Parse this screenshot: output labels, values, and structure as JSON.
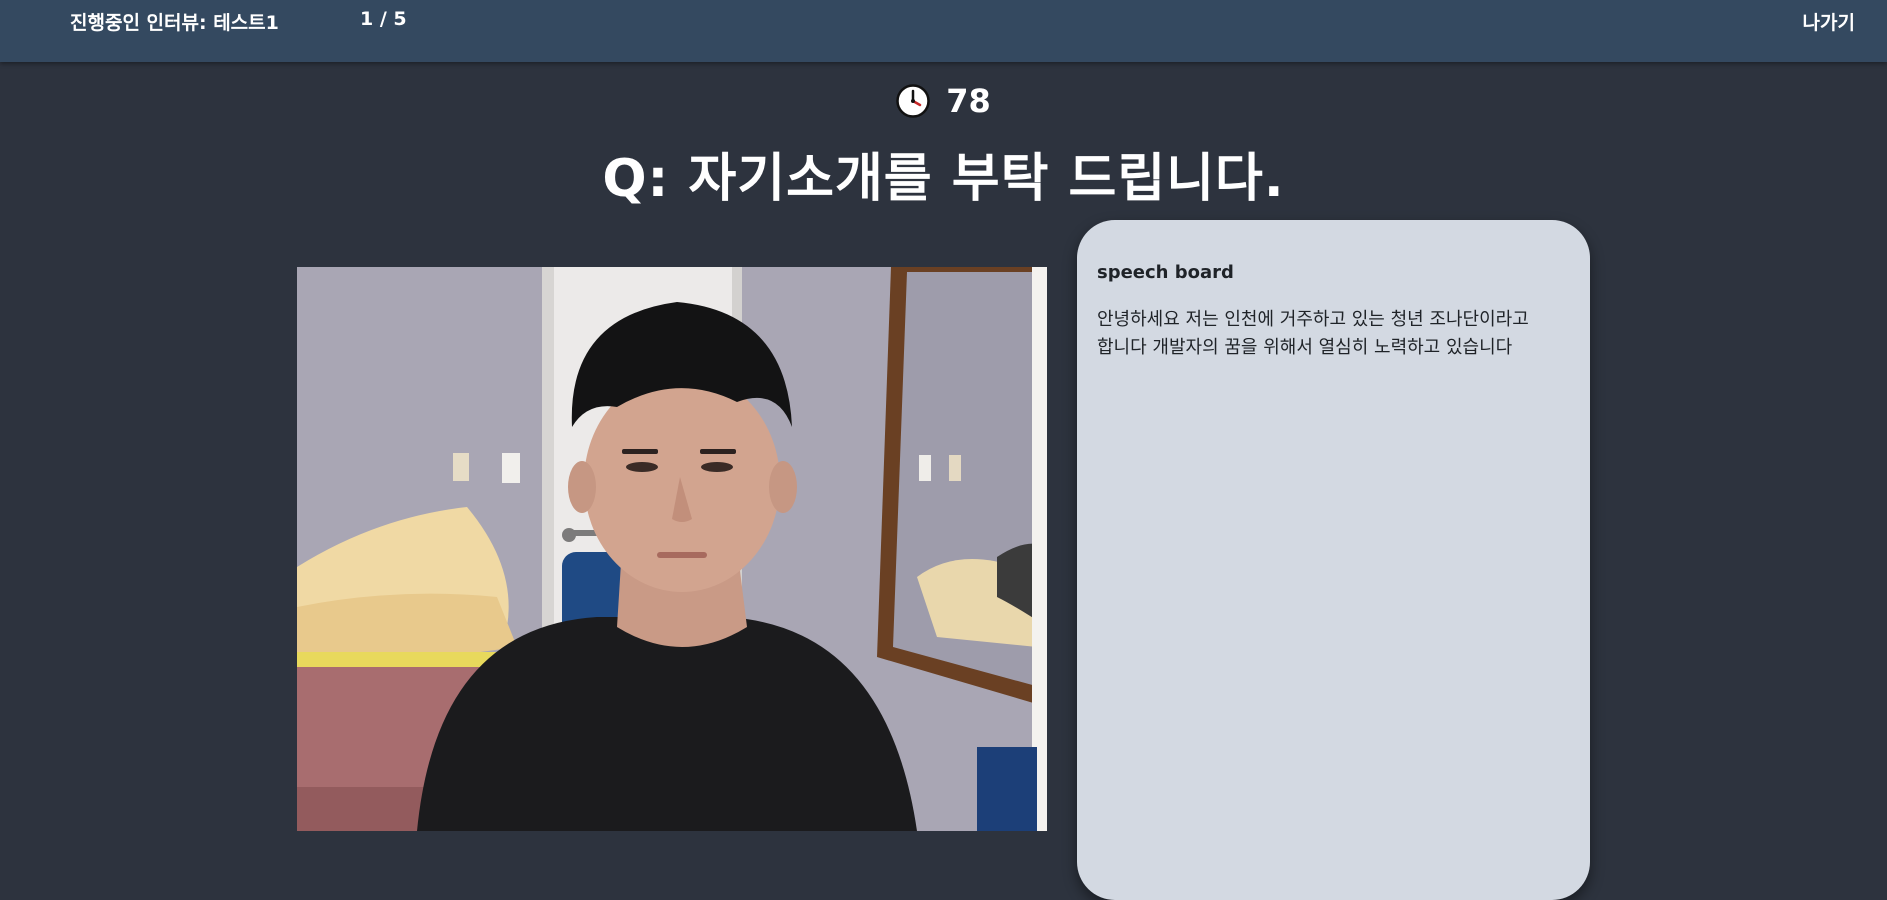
{
  "header": {
    "interview_title": "진행중인 인터뷰: 테스트1",
    "progress": "1 / 5",
    "exit_label": "나가기"
  },
  "timer": {
    "icon": "clock-icon",
    "seconds_left": "78"
  },
  "question": {
    "text": "Q: 자기소개를 부탁 드립니다."
  },
  "video": {
    "icon": "webcam-video-feed"
  },
  "speech_board": {
    "title": "speech board",
    "transcript": "안녕하세요 저는 인천에 거주하고 있는 청년 조나단이라고 합니다 개발자의 꿈을 위해서 열심히 노력하고 있습니다"
  },
  "colors": {
    "background": "#2d333e",
    "topbar": "#344960",
    "speech_board_bg": "#d3d9e2",
    "text_light": "#ffffff",
    "text_dark": "#1f2328"
  }
}
